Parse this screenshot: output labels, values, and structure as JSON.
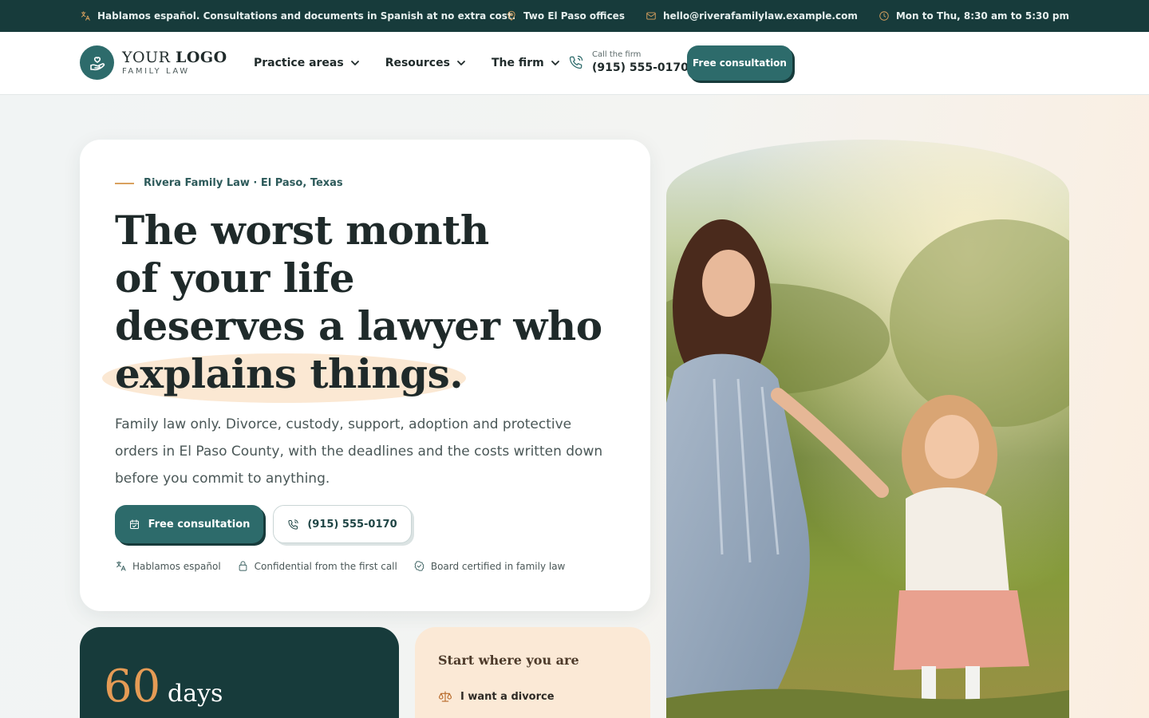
{
  "topbar": {
    "language_note": "Hablamos español. Consultations and documents in Spanish at no extra cost.",
    "offices": "Two El Paso offices",
    "email": "hello@riverafamilylaw.example.com",
    "hours": "Mon to Thu, 8:30 am to 5:30 pm"
  },
  "logo": {
    "word1": "YOUR",
    "word2": "LOGO",
    "tagline": "FAMILY LAW"
  },
  "nav": {
    "items": [
      {
        "label": "Practice areas"
      },
      {
        "label": "Resources"
      },
      {
        "label": "The firm"
      }
    ]
  },
  "call": {
    "label": "Call the firm",
    "phone": "(915) 555-0170"
  },
  "header_cta": "Free consultation",
  "hero": {
    "eyebrow": "Rivera Family Law · El Paso, Texas",
    "headline_lines": [
      "The worst month",
      "of your life",
      "deserves a lawyer who",
      "explains things."
    ],
    "subtext": "Family law only. Divorce, custody, support, adoption and protective orders in El Paso County, with the deadlines and the costs written down before you commit to anything.",
    "primary_button": "Free consultation",
    "secondary_button": "(915) 555-0170",
    "trust": [
      "Hablamos español",
      "Confidential from the first call",
      "Board certified in family law"
    ]
  },
  "stat": {
    "number": "60",
    "unit": "days"
  },
  "start": {
    "title": "Start where you are",
    "items": [
      {
        "label": "I want a divorce"
      }
    ]
  },
  "colors": {
    "brand_dark": "#173b3b",
    "brand": "#2d6b6b",
    "accent": "#d9a15f",
    "peach": "#fbe9d6"
  }
}
